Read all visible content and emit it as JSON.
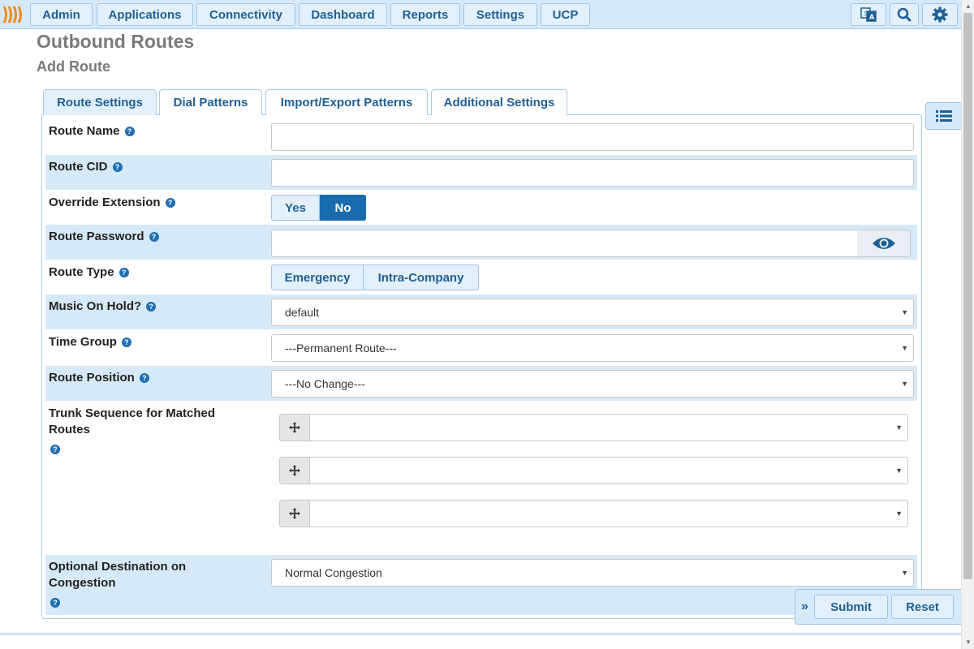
{
  "nav": {
    "items": [
      "Admin",
      "Applications",
      "Connectivity",
      "Dashboard",
      "Reports",
      "Settings",
      "UCP"
    ],
    "icons": [
      "translate-icon",
      "search-icon",
      "gear-icon"
    ]
  },
  "page": {
    "title": "Outbound Routes",
    "subtitle": "Add Route"
  },
  "tabs": [
    {
      "label": "Route Settings",
      "active": true
    },
    {
      "label": "Dial Patterns",
      "active": false
    },
    {
      "label": "Import/Export Patterns",
      "active": false
    },
    {
      "label": "Additional Settings",
      "active": false
    }
  ],
  "form": {
    "route_name": {
      "label": "Route Name",
      "value": ""
    },
    "route_cid": {
      "label": "Route CID",
      "value": ""
    },
    "override_extension": {
      "label": "Override Extension",
      "options": [
        "Yes",
        "No"
      ],
      "selected": "No"
    },
    "route_password": {
      "label": "Route Password",
      "value": ""
    },
    "route_type": {
      "label": "Route Type",
      "options": [
        "Emergency",
        "Intra-Company"
      ]
    },
    "music_on_hold": {
      "label": "Music On Hold?",
      "value": "default"
    },
    "time_group": {
      "label": "Time Group",
      "value": "---Permanent Route---"
    },
    "route_position": {
      "label": "Route Position",
      "value": "---No Change---"
    },
    "trunk_sequence": {
      "label": "Trunk Sequence for Matched Routes",
      "values": [
        "",
        "",
        ""
      ]
    },
    "congestion": {
      "label": "Optional Destination on Congestion",
      "value": "Normal Congestion"
    }
  },
  "actions": {
    "submit": "Submit",
    "reset": "Reset"
  },
  "colors": {
    "accent": "#1f5f96",
    "panel": "#d6e9f8",
    "active_toggle": "#1a6bad"
  }
}
